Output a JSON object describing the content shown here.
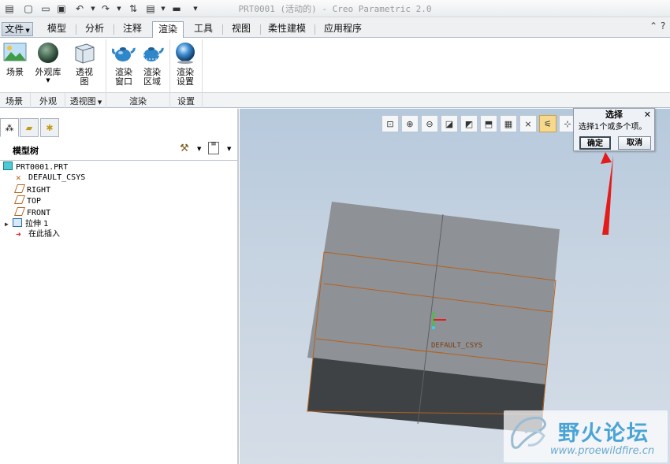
{
  "window": {
    "title": "PRT0001 (活动的) - Creo Parametric 2.0"
  },
  "quick_access": [
    {
      "icon": "new-icon",
      "glyph": "▢"
    },
    {
      "icon": "open-icon",
      "glyph": "▭"
    },
    {
      "icon": "save-icon",
      "glyph": "▣"
    },
    {
      "icon": "undo-icon",
      "glyph": "↶"
    },
    {
      "icon": "redo-icon",
      "glyph": "↷"
    },
    {
      "icon": "regenerate-icon",
      "glyph": "⇅"
    },
    {
      "icon": "windows-icon",
      "glyph": "▤"
    },
    {
      "icon": "close-window-icon",
      "glyph": "▬"
    }
  ],
  "menu": {
    "file": "文件",
    "tabs": [
      "模型",
      "分析",
      "注释",
      "渲染",
      "工具",
      "视图",
      "柔性建模",
      "应用程序"
    ],
    "active_tab": "渲染"
  },
  "ribbon": {
    "scene": "场景",
    "appearance_gallery": "外观库",
    "perspective_view": "透视图",
    "render_window": "渲染窗口",
    "render_region": "渲染区域",
    "render_setup": "渲染设置"
  },
  "groups": {
    "scene": "场景",
    "appearance": "外观",
    "perspective": "透视图",
    "render": "渲染",
    "settings": "设置"
  },
  "model_tree": {
    "title": "模型树",
    "items": [
      {
        "label": "PRT0001.PRT",
        "icon": "part-icon"
      },
      {
        "label": "DEFAULT_CSYS",
        "icon": "csys-icon"
      },
      {
        "label": "RIGHT",
        "icon": "datum-plane-icon"
      },
      {
        "label": "TOP",
        "icon": "datum-plane-icon"
      },
      {
        "label": "FRONT",
        "icon": "datum-plane-icon"
      },
      {
        "label": "拉伸 1",
        "icon": "extrude-icon"
      },
      {
        "label": "在此插入",
        "icon": "insert-here-icon"
      }
    ]
  },
  "viewport": {
    "csys_label": "DEFAULT_CSYS"
  },
  "select_dialog": {
    "title": "选择",
    "message": "选择1个或多个项。",
    "ok": "确定",
    "cancel": "取消"
  },
  "watermark": {
    "text": "野火论坛",
    "url": "www.proewildfire.cn"
  },
  "colors": {
    "accent": "#2b6cb0",
    "arrow": "#e41b1b",
    "part_light": "#8e9196",
    "part_dark": "#3f4244",
    "edge": "#b5621c"
  }
}
